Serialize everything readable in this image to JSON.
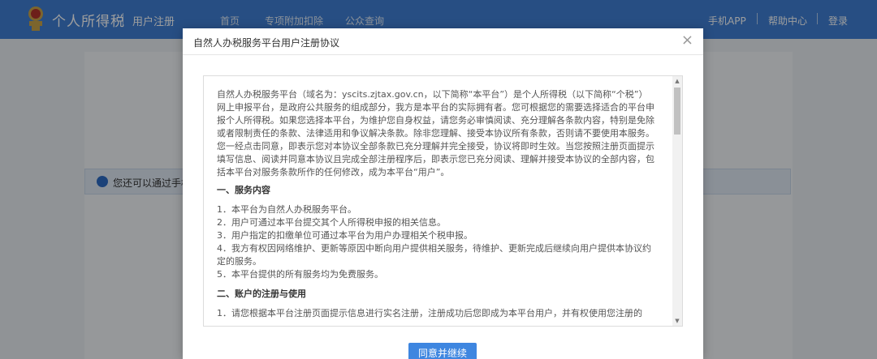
{
  "header": {
    "brand": "个人所得税",
    "subtitle": "用户注册",
    "nav": [
      "首页",
      "专项附加扣除",
      "公众查询"
    ],
    "right_links": [
      "手机APP",
      "帮助中心",
      "登录"
    ],
    "logo_icon": "tax-emblem-icon"
  },
  "page": {
    "info_text": "您还可以通过手机"
  },
  "modal": {
    "title": "自然人办税服务平台用户注册协议",
    "close_icon": "×",
    "intro": "自然人办税服务平台（域名为：yscits.zjtax.gov.cn，以下简称“本平台”）是个人所得税（以下简称“个税”）网上申报平台，是政府公共服务的组成部分，我方是本平台的实际拥有者。您可根据您的需要选择适合的平台申报个人所得税。如果您选择本平台，为维护您自身权益，请您务必审慎阅读、充分理解各条款内容，特别是免除或者限制责任的条款、法律适用和争议解决条款。除非您理解、接受本协议所有条款，否则请不要使用本服务。您一经点击同意，即表示您对本协议全部条款已充分理解并完全接受，协议将即时生效。当您按照注册页面提示填写信息、阅读并同意本协议且完成全部注册程序后，即表示您已充分阅读、理解并接受本协议的全部内容，包括本平台对服务条款所作的任何修改，成为本平台“用户”。",
    "section1_title": "一、服务内容",
    "section1_items": [
      "1．本平台为自然人办税服务平台。",
      "2．用户可通过本平台提交其个人所得税申报的相关信息。",
      "3．用户指定的扣缴单位可通过本平台为用户办理相关个税申报。",
      "4．我方有权因网络维护、更新等原因中断向用户提供相关服务，待维护、更新完成后继续向用户提供本协议约定的服务。",
      "5．本平台提供的所有服务均为免费服务。"
    ],
    "section2_title": "二、账户的注册与使用",
    "section2_items": [
      "1．请您根据本平台注册页面提示信息进行实名注册，注册成功后您即成为本平台用户，并有权使用您注册的"
    ],
    "agree_button": "同意并继续"
  },
  "colors": {
    "header_bg": "#3f7fd4",
    "button_bg": "#3e86e0",
    "info_icon": "#2d6bc3"
  }
}
